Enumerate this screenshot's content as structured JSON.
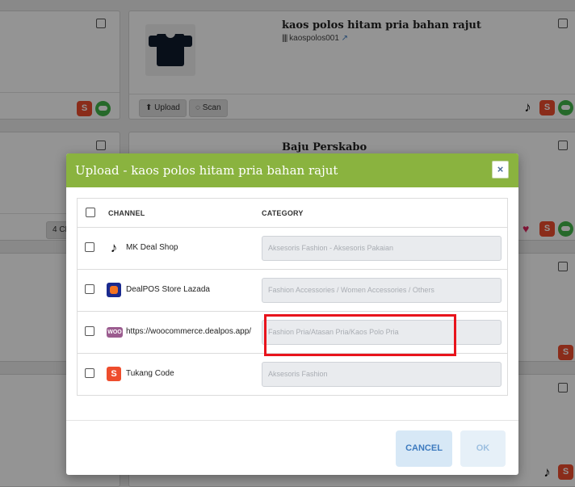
{
  "background": {
    "product_1": {
      "title": "kaos polos hitam pria bahan rajut",
      "sku": "kaospolos001",
      "upload_label": "Upload",
      "scan_label": "Scan"
    },
    "product_2": {
      "title": "Baju Perskabo"
    },
    "partial_badge": "4 CH"
  },
  "modal": {
    "title": "Upload - kaos polos hitam pria bahan rajut",
    "close_label": "×",
    "columns": {
      "channel": "CHANNEL",
      "category": "CATEGORY"
    },
    "rows": [
      {
        "channel": "MK Deal Shop",
        "icon": "tiktok-icon",
        "category": "Aksesoris Fashion - Aksesoris Pakaian"
      },
      {
        "channel": "DealPOS Store Lazada",
        "icon": "lazada-icon",
        "category": "Fashion Accessories / Women Accessories / Others"
      },
      {
        "channel": "https://woocommerce.dealpos.app/",
        "icon": "woocommerce-icon",
        "category": "Fashion Pria/Atasan Pria/Kaos Polo Pria"
      },
      {
        "channel": "Tukang Code",
        "icon": "shopee-icon",
        "category": "Aksesoris Fashion"
      }
    ],
    "cancel_label": "CANCEL",
    "ok_label": "OK"
  },
  "colors": {
    "header_green": "#8ab33f",
    "highlight_red": "#e8141c",
    "cancel_blue": "#3e7bbf"
  }
}
